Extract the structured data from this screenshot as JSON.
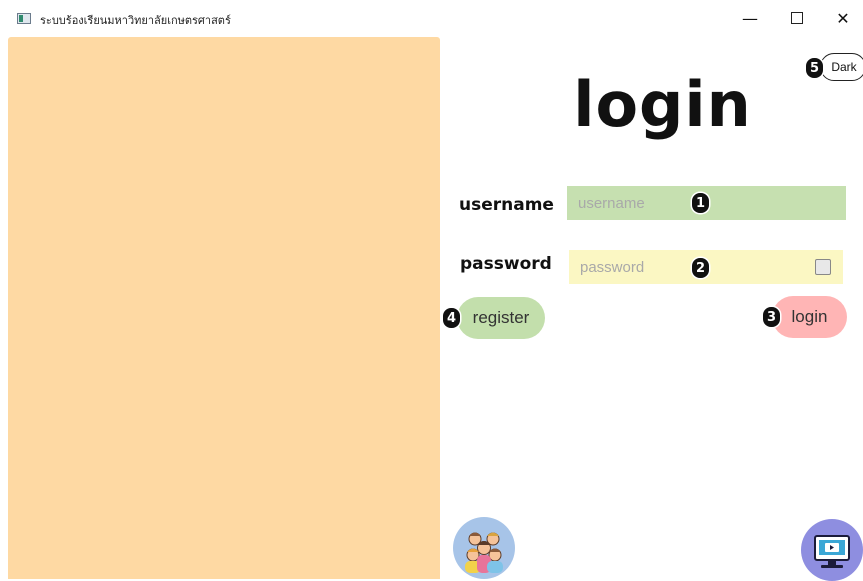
{
  "window": {
    "title": "ระบบร้องเรียนมหาวิทยาลัยเกษตรศาสตร์",
    "minimize_glyph": "—",
    "close_glyph": "✕"
  },
  "colors": {
    "left_panel": "#fed9a3",
    "username_field": "#c6e0b0",
    "password_field": "#fbf7c3",
    "register_button": "#c3dfac",
    "login_button": "#ffb5b5",
    "avatar_button": "#a7c4e8",
    "tv_button": "#8e8ee0"
  },
  "main": {
    "heading": "login",
    "theme_toggle_label": "Dark"
  },
  "form": {
    "username_label": "username",
    "username_placeholder": "username",
    "username_value": "",
    "password_label": "password",
    "password_placeholder": "password",
    "password_value": "",
    "show_password_checked": false,
    "register_label": "register",
    "login_label": "login"
  },
  "badges": [
    "1",
    "2",
    "3",
    "4",
    "5"
  ],
  "icons": {
    "bottom_left": "people-group-icon",
    "bottom_right": "monitor-video-icon"
  }
}
